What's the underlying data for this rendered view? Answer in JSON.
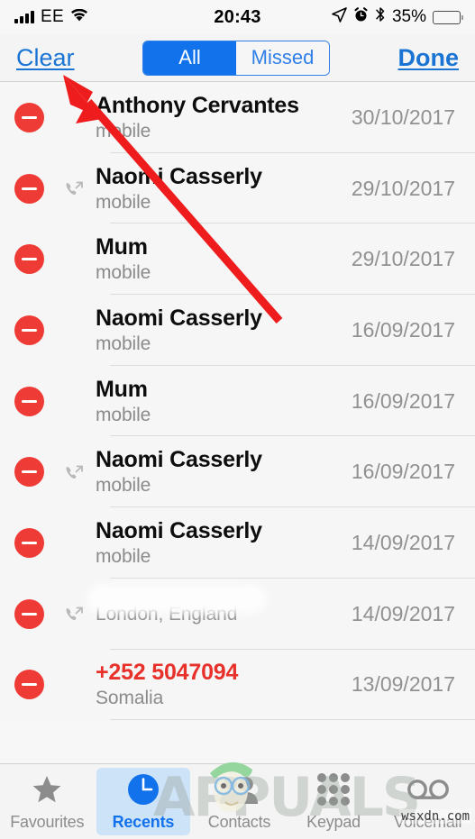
{
  "status_bar": {
    "carrier": "EE",
    "time": "20:43",
    "battery_percent": "35%",
    "icons": [
      "signal-bars-icon",
      "wifi-icon",
      "location-arrow-icon",
      "alarm-clock-icon",
      "bluetooth-icon",
      "battery-icon"
    ]
  },
  "nav": {
    "clear_label": "Clear",
    "done_label": "Done",
    "segments": [
      {
        "label": "All",
        "selected": true
      },
      {
        "label": "Missed",
        "selected": false
      }
    ]
  },
  "calls": [
    {
      "name": "Anthony Cervantes",
      "subtitle": "mobile",
      "date": "30/10/2017",
      "direction": "incoming",
      "missed": false,
      "redacted": false
    },
    {
      "name": "Naomi Casserly",
      "subtitle": "mobile",
      "date": "29/10/2017",
      "direction": "outgoing",
      "missed": false,
      "redacted": false
    },
    {
      "name": "Mum",
      "subtitle": "mobile",
      "date": "29/10/2017",
      "direction": "incoming",
      "missed": false,
      "redacted": false
    },
    {
      "name": "Naomi Casserly",
      "subtitle": "mobile",
      "date": "16/09/2017",
      "direction": "incoming",
      "missed": false,
      "redacted": false
    },
    {
      "name": "Mum",
      "subtitle": "mobile",
      "date": "16/09/2017",
      "direction": "incoming",
      "missed": false,
      "redacted": false
    },
    {
      "name": "Naomi Casserly",
      "subtitle": "mobile",
      "date": "16/09/2017",
      "direction": "outgoing",
      "missed": false,
      "redacted": false
    },
    {
      "name": "Naomi Casserly",
      "subtitle": "mobile",
      "date": "14/09/2017",
      "direction": "incoming",
      "missed": false,
      "redacted": false
    },
    {
      "name": "",
      "subtitle": "London, England",
      "date": "14/09/2017",
      "direction": "outgoing",
      "missed": false,
      "redacted": true
    },
    {
      "name": "+252 5047094",
      "subtitle": "Somalia",
      "date": "13/09/2017",
      "direction": "incoming",
      "missed": true,
      "redacted": false
    }
  ],
  "tabs": [
    {
      "label": "Favourites",
      "icon": "star-icon",
      "active": false
    },
    {
      "label": "Recents",
      "icon": "clock-icon",
      "active": true
    },
    {
      "label": "Contacts",
      "icon": "people-icon",
      "active": false
    },
    {
      "label": "Keypad",
      "icon": "keypad-dots-icon",
      "active": false
    },
    {
      "label": "Voicemail",
      "icon": "voicemail-icon",
      "active": false
    }
  ],
  "annotations": {
    "arrow_color": "#ee1c1c",
    "arrow_target": "Clear"
  },
  "watermark": {
    "brand": "APPUALS",
    "site": "wsxdn.com"
  },
  "colors": {
    "accent_blue": "#1272ec",
    "delete_red": "#ef3b35",
    "missed_red": "#e8312a",
    "bg": "#f6f6f6"
  }
}
